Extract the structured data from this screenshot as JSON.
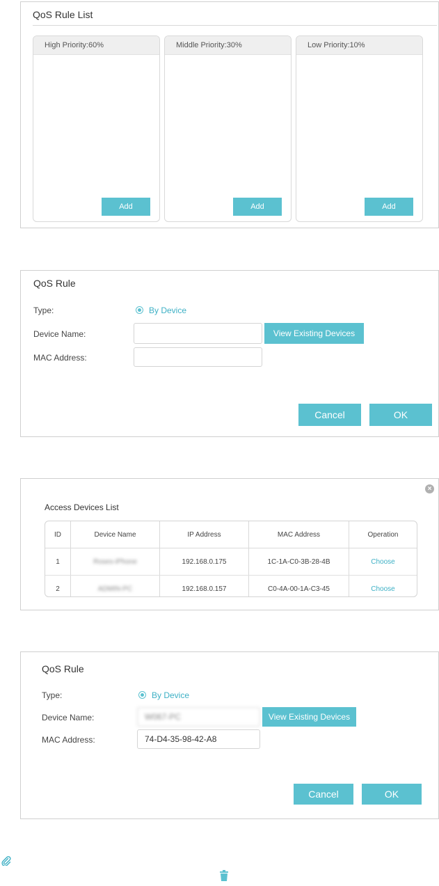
{
  "qos_rule_list": {
    "title": "QoS Rule List",
    "columns": [
      {
        "label": "High Priority:60%",
        "add_label": "Add"
      },
      {
        "label": "Middle Priority:30%",
        "add_label": "Add"
      },
      {
        "label": "Low Priority:10%",
        "add_label": "Add"
      }
    ]
  },
  "rule_form_1": {
    "title": "QoS Rule",
    "type_label": "Type:",
    "type_value": "By Device",
    "device_name_label": "Device Name:",
    "device_name_value": "",
    "mac_label": "MAC Address:",
    "mac_value": "",
    "view_devices_label": "View Existing Devices",
    "cancel_label": "Cancel",
    "ok_label": "OK"
  },
  "devices_list": {
    "title": "Access Devices List",
    "headers": [
      "ID",
      "Device Name",
      "IP Address",
      "MAC Address",
      "Operation"
    ],
    "rows": [
      {
        "id": "1",
        "name": "Roses-iPhone",
        "ip": "192.168.0.175",
        "mac": "1C-1A-C0-3B-28-4B",
        "op": "Choose"
      },
      {
        "id": "2",
        "name": "ADMIN-PC",
        "ip": "192.168.0.157",
        "mac": "C0-4A-00-1A-C3-45",
        "op": "Choose"
      }
    ]
  },
  "rule_form_2": {
    "title": "QoS Rule",
    "type_label": "Type:",
    "type_value": "By Device",
    "device_name_label": "Device Name:",
    "device_name_value": "W067-PC",
    "mac_label": "MAC Address:",
    "mac_value": "74-D4-35-98-42-A8",
    "view_devices_label": "View Existing Devices",
    "cancel_label": "Cancel",
    "ok_label": "OK"
  },
  "colors": {
    "accent": "#5bc1d0",
    "accent_text": "#3db0c5",
    "border": "#cfcfcf"
  },
  "icons": {
    "attachment": "paperclip-icon",
    "delete": "trash-icon",
    "close": "close-icon"
  }
}
